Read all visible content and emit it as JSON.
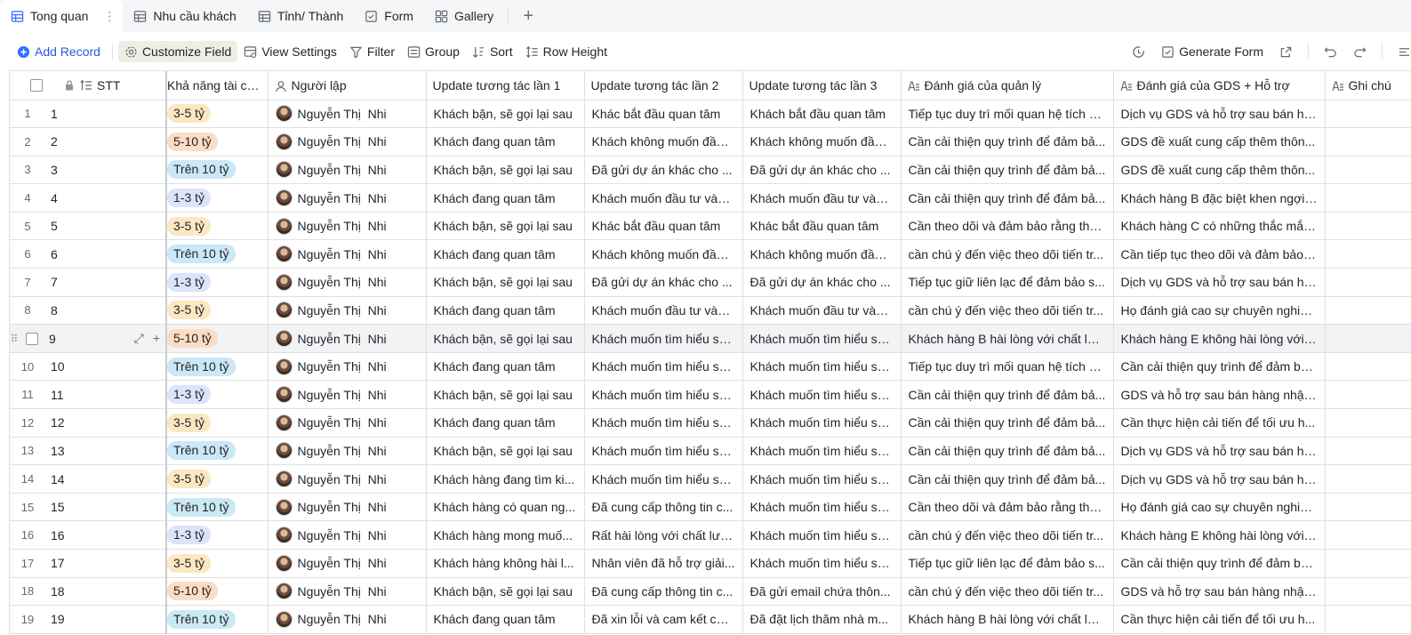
{
  "tabs": [
    {
      "label": "Tong quan",
      "icon": "grid-view-icon",
      "active": true
    },
    {
      "label": "Nhu cầu khách",
      "icon": "grid-view-icon"
    },
    {
      "label": "Tỉnh/ Thành",
      "icon": "grid-view-icon"
    },
    {
      "label": "Form",
      "icon": "form-icon"
    },
    {
      "label": "Gallery",
      "icon": "gallery-icon"
    }
  ],
  "toolbar": {
    "add_record": "Add Record",
    "customize_field": "Customize Field",
    "view_settings": "View Settings",
    "filter": "Filter",
    "group": "Group",
    "sort": "Sort",
    "row_height": "Row Height",
    "generate_form": "Generate Form"
  },
  "columns": {
    "stt": "STT",
    "kha_nang": "Khả năng tài ch...",
    "nguoi_lap": "Người lập",
    "update1": "Update tương tác lần 1",
    "update2": "Update tương tác lần 2",
    "update3": "Update tương tác lần 3",
    "danh_gia_ql": "Đánh giá của quản lý",
    "danh_gia_gds": "Đánh giá của GDS + Hỗ trợ",
    "ghi_chu": "Ghi chú"
  },
  "rows": [
    {
      "n": "1",
      "stt": "1",
      "kn": "3-5 tỷ",
      "kt": "a",
      "person": "Nguyễn Thị  Nhi",
      "u1": "Khách bận, sẽ gọi lại sau",
      "u2": "Khác bắt đầu quan tâm",
      "u3": "Khách bắt đầu quan tâm",
      "ql": "Tiếp tục duy trì mối quan hệ tích c...",
      "gds": "Dịch vụ GDS và hỗ trợ sau bán hà...",
      "gc": ""
    },
    {
      "n": "2",
      "stt": "2",
      "kn": "5-10 tỷ",
      "kt": "b",
      "person": "Nguyễn Thị  Nhi",
      "u1": "Khách đang quan tâm",
      "u2": "Khách không muốn đầu ...",
      "u3": "Khách không muốn đầu ...",
      "ql": "Cần cải thiện quy trình để đảm bả...",
      "gds": "GDS đề xuất cung cấp thêm thôn...",
      "gc": ""
    },
    {
      "n": "3",
      "stt": "3",
      "kn": "Trên 10 tỷ",
      "kt": "c",
      "person": "Nguyễn Thị  Nhi",
      "u1": "Khách bận, sẽ gọi lại sau",
      "u2": "Đã gửi dự án khác cho ...",
      "u3": "Đã gửi dự án khác cho ...",
      "ql": "Cần cải thiện quy trình để đảm bả...",
      "gds": "GDS đề xuất cung cấp thêm thôn...",
      "gc": ""
    },
    {
      "n": "4",
      "stt": "4",
      "kn": "1-3 tỷ",
      "kt": "d",
      "person": "Nguyễn Thị  Nhi",
      "u1": "Khách đang quan tâm",
      "u2": "Khách muốn đầu tư vào...",
      "u3": "Khách muốn đầu tư vào...",
      "ql": "Cần cải thiện quy trình để đảm bả...",
      "gds": "Khách hàng B đặc biệt khen ngợi ...",
      "gc": ""
    },
    {
      "n": "5",
      "stt": "5",
      "kn": "3-5 tỷ",
      "kt": "a",
      "person": "Nguyễn Thị  Nhi",
      "u1": "Khách bận, sẽ gọi lại sau",
      "u2": "Khác bắt đầu quan tâm",
      "u3": "Khác bắt đầu quan tâm",
      "ql": "Cần theo dõi và đảm bảo rằng thô...",
      "gds": "Khách hàng C có những thắc mắc...",
      "gc": ""
    },
    {
      "n": "6",
      "stt": "6",
      "kn": "Trên 10 tỷ",
      "kt": "c",
      "person": "Nguyễn Thị  Nhi",
      "u1": "Khách đang quan tâm",
      "u2": "Khách không muốn đầu ...",
      "u3": "Khách không muốn đầu ...",
      "ql": "cần chú ý đến việc theo dõi tiến tr...",
      "gds": "Cần tiếp tục theo dõi và đảm bảo ...",
      "gc": ""
    },
    {
      "n": "7",
      "stt": "7",
      "kn": "1-3 tỷ",
      "kt": "d",
      "person": "Nguyễn Thị  Nhi",
      "u1": "Khách bận, sẽ gọi lại sau",
      "u2": "Đã gửi dự án khác cho ...",
      "u3": "Đã gửi dự án khác cho ...",
      "ql": "Tiếp tục giữ liên lạc để đảm bảo s...",
      "gds": "Dịch vụ GDS và hỗ trợ sau bán hà...",
      "gc": ""
    },
    {
      "n": "8",
      "stt": "8",
      "kn": "3-5 tỷ",
      "kt": "a",
      "person": "Nguyễn Thị  Nhi",
      "u1": "Khách đang quan tâm",
      "u2": "Khách muốn đầu tư vào...",
      "u3": "Khách muốn đầu tư vào...",
      "ql": "cần chú ý đến việc theo dõi tiến tr...",
      "gds": "Họ đánh giá cao sự chuyên nghiệ...",
      "gc": ""
    },
    {
      "n": "9",
      "stt": "9",
      "kn": "5-10 tỷ",
      "kt": "b",
      "person": "Nguyễn Thị  Nhi",
      "u1": "Khách bận, sẽ gọi lại sau",
      "u2": "Khách muốn tìm hiểu sâ...",
      "u3": "Khách muốn tìm hiểu sâ...",
      "ql": "Khách hàng B hài lòng với chất lư...",
      "gds": "Khách hàng E không hài lòng với t...",
      "gc": "",
      "hover": true
    },
    {
      "n": "10",
      "stt": "10",
      "kn": "Trên 10 tỷ",
      "kt": "c",
      "person": "Nguyễn Thị  Nhi",
      "u1": "Khách đang quan tâm",
      "u2": "Khách muốn tìm hiểu sâ...",
      "u3": "Khách muốn tìm hiểu sâ...",
      "ql": "Tiếp tục duy trì mối quan hệ tích c...",
      "gds": "Cần cải thiện quy trình để đảm bả...",
      "gc": ""
    },
    {
      "n": "11",
      "stt": "11",
      "kn": "1-3 tỷ",
      "kt": "d",
      "person": "Nguyễn Thị  Nhi",
      "u1": "Khách bận, sẽ gọi lại sau",
      "u2": "Khách muốn tìm hiểu sâ...",
      "u3": "Khách muốn tìm hiểu sâ...",
      "ql": "Cần cải thiện quy trình để đảm bả...",
      "gds": "GDS và hỗ trợ sau bán hàng nhận...",
      "gc": ""
    },
    {
      "n": "12",
      "stt": "12",
      "kn": "3-5 tỷ",
      "kt": "a",
      "person": "Nguyễn Thị  Nhi",
      "u1": "Khách đang quan tâm",
      "u2": "Khách muốn tìm hiểu sâ...",
      "u3": "Khách muốn tìm hiểu sâ...",
      "ql": "Cần cải thiện quy trình để đảm bả...",
      "gds": "Cần thực hiện cải tiến để tối ưu h...",
      "gc": ""
    },
    {
      "n": "13",
      "stt": "13",
      "kn": "Trên 10 tỷ",
      "kt": "c",
      "person": "Nguyễn Thị  Nhi",
      "u1": "Khách bận, sẽ gọi lại sau",
      "u2": "Khách muốn tìm hiểu sâ...",
      "u3": "Khách muốn tìm hiểu sâ...",
      "ql": "Cần cải thiện quy trình để đảm bả...",
      "gds": "Dịch vụ GDS và hỗ trợ sau bán hà...",
      "gc": ""
    },
    {
      "n": "14",
      "stt": "14",
      "kn": "3-5 tỷ",
      "kt": "a",
      "person": "Nguyễn Thị  Nhi",
      "u1": "Khách hàng đang tìm ki...",
      "u2": "Khách muốn tìm hiểu sâ...",
      "u3": "Khách muốn tìm hiểu sâ...",
      "ql": "Cần cải thiện quy trình để đảm bả...",
      "gds": "Dịch vụ GDS và hỗ trợ sau bán hà...",
      "gc": ""
    },
    {
      "n": "15",
      "stt": "15",
      "kn": "Trên 10 tỷ",
      "kt": "c",
      "person": "Nguyễn Thị  Nhi",
      "u1": "Khách hàng có quan ng...",
      "u2": "Đã cung cấp thông tin c...",
      "u3": "Khách muốn tìm hiểu sâ...",
      "ql": "Cần theo dõi và đảm bảo rằng thô...",
      "gds": "Họ đánh giá cao sự chuyên nghiệ...",
      "gc": ""
    },
    {
      "n": "16",
      "stt": "16",
      "kn": "1-3 tỷ",
      "kt": "d",
      "person": "Nguyễn Thị  Nhi",
      "u1": "Khách hàng mong muố...",
      "u2": "Rất hài lòng với chất lượ...",
      "u3": "Khách muốn tìm hiểu sâ...",
      "ql": "cần chú ý đến việc theo dõi tiến tr...",
      "gds": "Khách hàng E không hài lòng với t...",
      "gc": ""
    },
    {
      "n": "17",
      "stt": "17",
      "kn": "3-5 tỷ",
      "kt": "a",
      "person": "Nguyễn Thị  Nhi",
      "u1": "Khách hàng không hài l...",
      "u2": "Nhân viên đã hỗ trợ giải...",
      "u3": "Khách muốn tìm hiểu sâ...",
      "ql": "Tiếp tục giữ liên lạc để đảm bảo s...",
      "gds": "Cần cải thiện quy trình để đảm bả...",
      "gc": ""
    },
    {
      "n": "18",
      "stt": "18",
      "kn": "5-10 tỷ",
      "kt": "b",
      "person": "Nguyễn Thị  Nhi",
      "u1": "Khách bận, sẽ gọi lại sau",
      "u2": "Đã cung cấp thông tin c...",
      "u3": "Đã gửi email chứa thôn...",
      "ql": "cần chú ý đến việc theo dõi tiến tr...",
      "gds": "GDS và hỗ trợ sau bán hàng nhận...",
      "gc": ""
    },
    {
      "n": "19",
      "stt": "19",
      "kn": "Trên 10 tỷ",
      "kt": "c",
      "person": "Nguyễn Thị  Nhi",
      "u1": "Khách đang quan tâm",
      "u2": "Đã xin lỗi và cam kết cải...",
      "u3": "Đã đặt lịch thăm nhà m...",
      "ql": "Khách hàng B hài lòng với chất lư...",
      "gds": "Cần thực hiện cải tiến để tối ưu h...",
      "gc": ""
    }
  ]
}
